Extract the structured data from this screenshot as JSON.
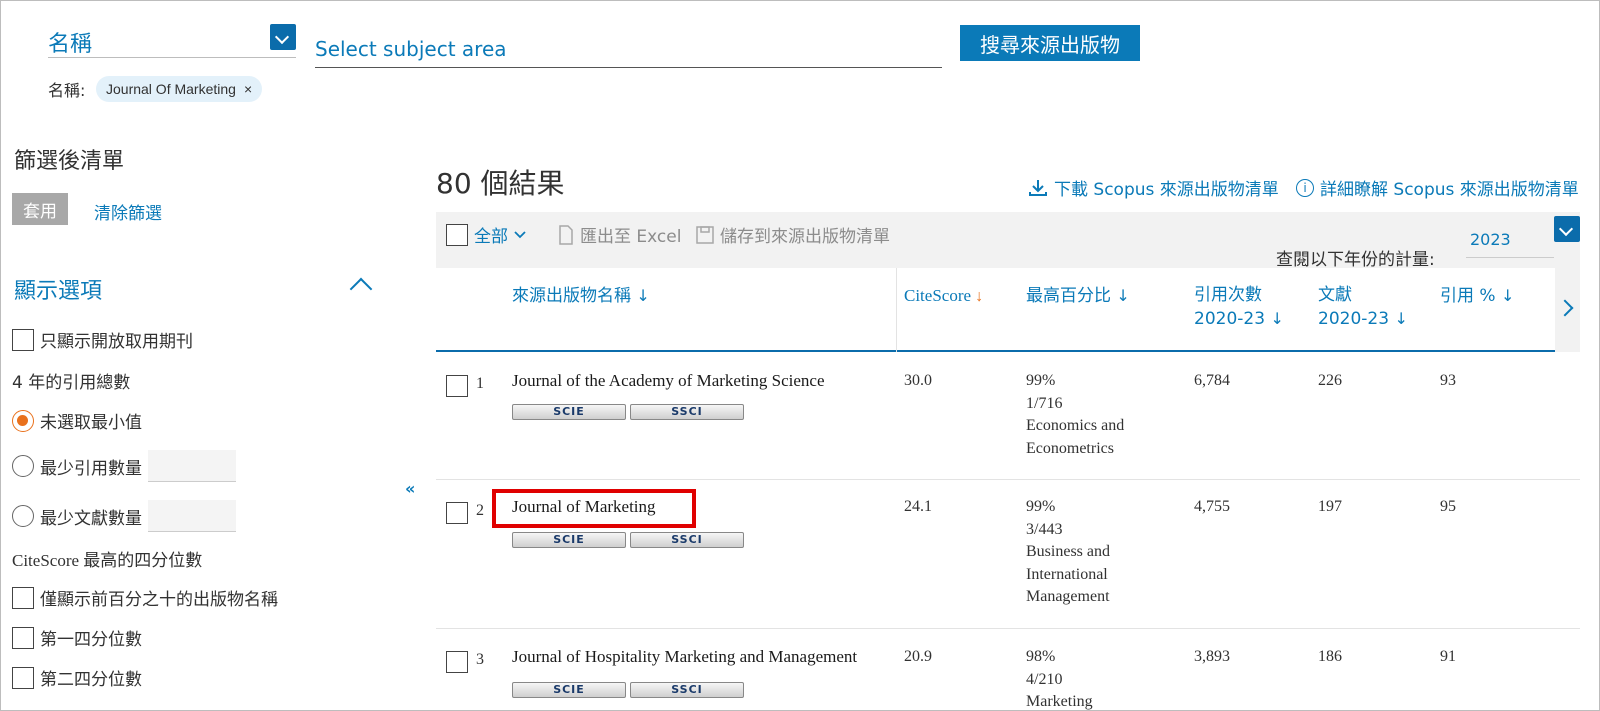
{
  "search": {
    "field_select": "名稱",
    "subject_placeholder": "Select subject area",
    "search_button": "搜尋來源出版物",
    "filter_label": "名稱:",
    "filter_chip": "Journal Of Marketing",
    "chip_remove": "×"
  },
  "left_panel": {
    "title": "篩選後清單",
    "apply_button": "套用",
    "clear_link": "清除篩選",
    "display_options_title": "顯示選項",
    "open_access_only": "只顯示開放取用期刊",
    "citations_heading": "4 年的引用總數",
    "radio_no_min": "未選取最小值",
    "radio_min_citations": "最少引用數量",
    "radio_min_docs": "最少文獻數量",
    "quartile_heading": "CiteScore 最高的四分位數",
    "top10": "僅顯示前百分之十的出版物名稱",
    "q1": "第一四分位數",
    "q2": "第二四分位數",
    "collapse_glyph": "«"
  },
  "results": {
    "count": "80 個結果",
    "download_link": "下載 Scopus 來源出版物清單",
    "info_link": "詳細瞭解 Scopus 來源出版物清單",
    "info_glyph": "i",
    "select_all": "全部",
    "export_excel": "匯出至 Excel",
    "save_list": "儲存到來源出版物清單",
    "year_label": "查閱以下年份的計量:",
    "year_value": "2023"
  },
  "columns": {
    "source_title": "來源出版物名稱",
    "citescore": "CiteScore",
    "highest_percentile": "最高百分比",
    "citations_line1": "引用次數",
    "citations_line2": "2020-23",
    "documents_line1": "文獻",
    "documents_line2": "2020-23",
    "cited_pct": "引用 %",
    "sort_arrow": "↓"
  },
  "rows": [
    {
      "num": "1",
      "title": "Journal of the Academy of Marketing Science",
      "badge1": "SCIE",
      "badge2": "SSCI",
      "citescore": "30.0",
      "pct": "99%",
      "rank": "1/716",
      "category_line1": "Economics and",
      "category_line2": "Econometrics",
      "category_line3": "",
      "citations": "6,784",
      "documents": "226",
      "cited": "93"
    },
    {
      "num": "2",
      "title": "Journal of Marketing",
      "badge1": "SCIE",
      "badge2": "SSCI",
      "citescore": "24.1",
      "pct": "99%",
      "rank": "3/443",
      "category_line1": "Business and",
      "category_line2": "International",
      "category_line3": "Management",
      "citations": "4,755",
      "documents": "197",
      "cited": "95"
    },
    {
      "num": "3",
      "title": "Journal of Hospitality Marketing and Management",
      "badge1": "SCIE",
      "badge2": "SSCI",
      "citescore": "20.9",
      "pct": "98%",
      "rank": "4/210",
      "category_line1": "Marketing",
      "category_line2": "",
      "category_line3": "",
      "citations": "3,893",
      "documents": "186",
      "cited": "91"
    }
  ],
  "colors": {
    "accent": "#0b7ab8",
    "sort_active": "#e9711c",
    "highlight": "#e00000"
  }
}
